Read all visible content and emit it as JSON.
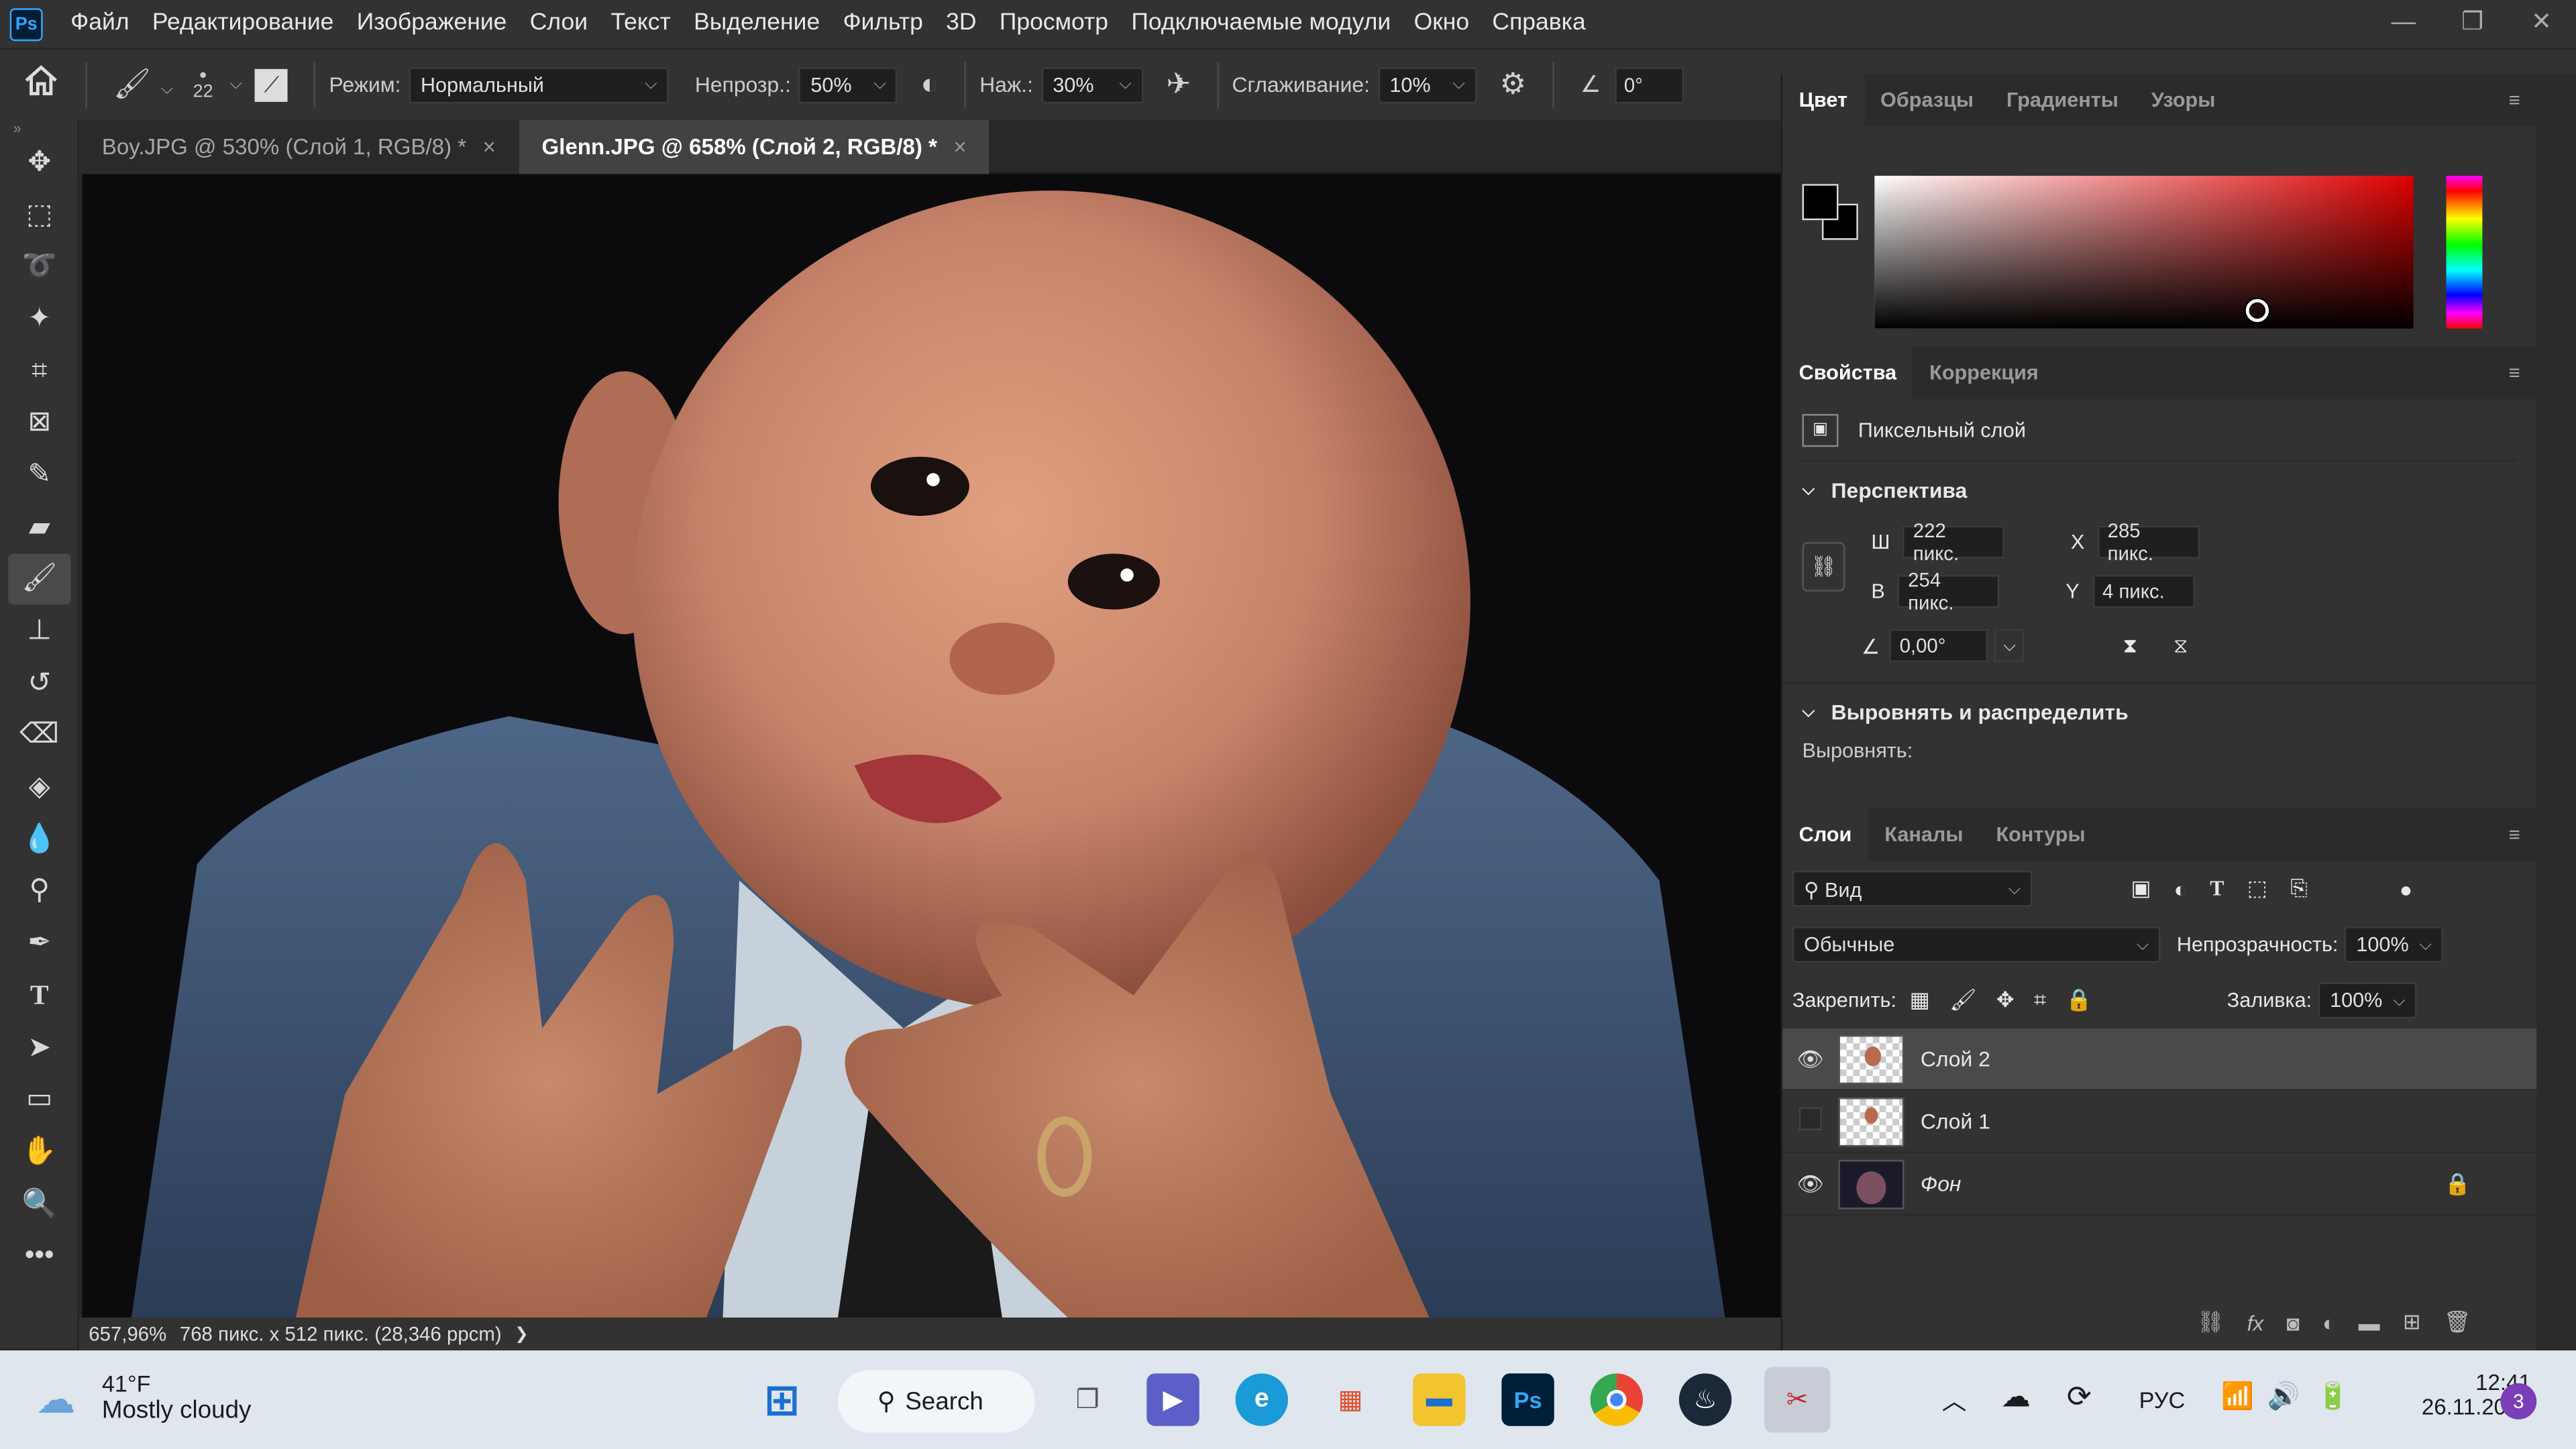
{
  "menu": {
    "items": [
      "Файл",
      "Редактирование",
      "Изображение",
      "Слои",
      "Текст",
      "Выделение",
      "Фильтр",
      "3D",
      "Просмотр",
      "Подключаемые модули",
      "Окно",
      "Справка"
    ],
    "logo": "Ps"
  },
  "options": {
    "brush_size": "22",
    "mode_label": "Режим:",
    "mode_value": "Нормальный",
    "opacity_label": "Непрозр.:",
    "opacity_value": "50%",
    "flow_label": "Наж.:",
    "flow_value": "30%",
    "smoothing_label": "Сглаживание:",
    "smoothing_value": "10%",
    "angle_value": "0°"
  },
  "tabs": [
    {
      "label": "Boy.JPG @ 530% (Слой 1, RGB/8) *",
      "active": false
    },
    {
      "label": "Glenn.JPG @ 658% (Слой 2, RGB/8) *",
      "active": true
    }
  ],
  "tab_close": "×",
  "status": {
    "zoom": "657,96%",
    "doc_info": "768 пикс. x 512 пикс. (28,346 ppcm)",
    "arrow": "❯"
  },
  "color_panel": {
    "tabs": [
      "Цвет",
      "Образцы",
      "Градиенты",
      "Узоры"
    ],
    "accent": "#e00000"
  },
  "properties_panel": {
    "tabs": [
      "Свойства",
      "Коррекция"
    ],
    "layer_type": "Пиксельный слой",
    "perspective_title": "Перспектива",
    "w_label": "Ш",
    "w_value": "222 пикс.",
    "h_label": "В",
    "h_value": "254 пикс.",
    "x_label": "X",
    "x_value": "285 пикс.",
    "y_label": "Y",
    "y_value": "4 пикс.",
    "angle_value": "0,00°",
    "align_title": "Выровнять и распределить",
    "align_label": "Выровнять:"
  },
  "layers_panel": {
    "tabs": [
      "Слои",
      "Каналы",
      "Контуры"
    ],
    "filter_value": "Вид",
    "blend_value": "Обычные",
    "opacity_label": "Непрозрачность:",
    "opacity_value": "100%",
    "lock_label": "Закрепить:",
    "fill_label": "Заливка:",
    "fill_value": "100%",
    "layers": [
      {
        "name": "Слой 2",
        "visible": true,
        "selected": true
      },
      {
        "name": "Слой 1",
        "visible": false,
        "selected": false
      },
      {
        "name": "Фон",
        "visible": true,
        "selected": false,
        "locked": true
      }
    ]
  },
  "taskbar": {
    "weather_temp": "41°F",
    "weather_desc": "Mostly cloudy",
    "search_label": "Search",
    "lang": "РУС",
    "time": "12:41",
    "date": "26.11.2022",
    "notification_count": "3"
  }
}
